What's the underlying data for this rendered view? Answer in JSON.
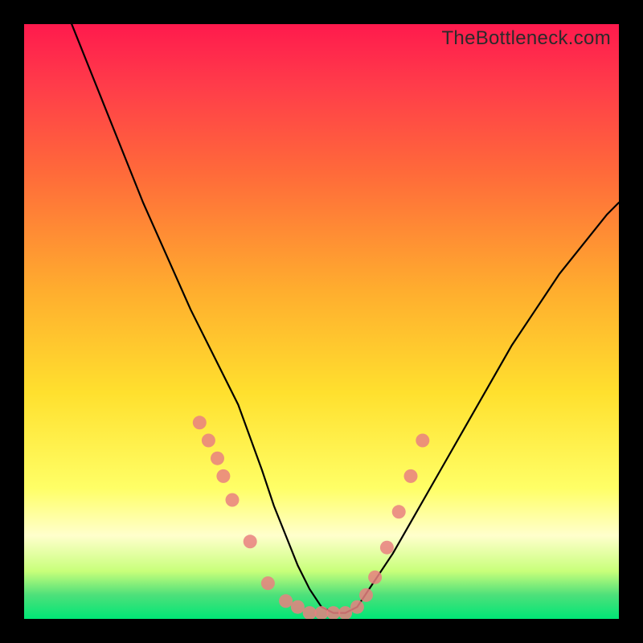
{
  "watermark": "TheBottleneck.com",
  "chart_data": {
    "type": "line",
    "title": "",
    "subtitle": "",
    "xlabel": "",
    "ylabel": "",
    "xlim": [
      0,
      100
    ],
    "ylim": [
      0,
      100
    ],
    "annotations": [
      "Background gradient from red (high bottleneck) to green (low bottleneck)"
    ],
    "series": [
      {
        "name": "bottleneck-curve",
        "style": "black-line",
        "x": [
          8,
          12,
          16,
          20,
          24,
          28,
          32,
          36,
          40,
          42,
          44,
          46,
          48,
          50,
          52,
          54,
          56,
          58,
          62,
          66,
          70,
          74,
          78,
          82,
          86,
          90,
          94,
          98,
          100
        ],
        "y": [
          100,
          90,
          80,
          70,
          61,
          52,
          44,
          36,
          25,
          19,
          14,
          9,
          5,
          2,
          1,
          1,
          2,
          5,
          11,
          18,
          25,
          32,
          39,
          46,
          52,
          58,
          63,
          68,
          70
        ]
      },
      {
        "name": "bottleneck-markers",
        "style": "salmon-dots",
        "x": [
          29.5,
          31,
          32.5,
          33.5,
          35,
          38,
          41,
          44,
          46,
          48,
          50,
          52,
          54,
          56,
          57.5,
          59,
          61,
          63,
          65,
          67
        ],
        "y": [
          33,
          30,
          27,
          24,
          20,
          13,
          6,
          3,
          2,
          1,
          1,
          1,
          1,
          2,
          4,
          7,
          12,
          18,
          24,
          30
        ]
      }
    ]
  }
}
